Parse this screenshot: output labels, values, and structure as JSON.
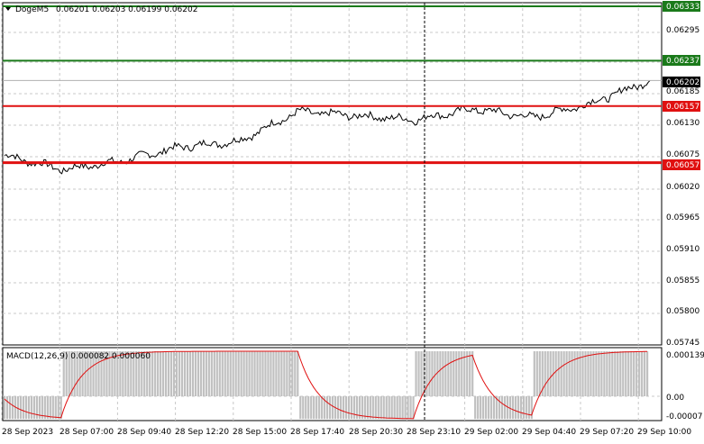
{
  "header": {
    "symbol_line": "DogeM5",
    "ohlc": "0.06201 0.06203 0.06199 0.06202"
  },
  "price_axis": {
    "ticks": [
      "0.06295",
      "0.06185",
      "0.06130",
      "0.06075",
      "0.06020",
      "0.05965",
      "0.05910",
      "0.05855",
      "0.05800",
      "0.05745"
    ]
  },
  "levels": [
    {
      "price": "0.06333",
      "color": "#1a7a1a"
    },
    {
      "price": "0.06237",
      "color": "#1a7a1a"
    },
    {
      "price": "0.06157",
      "color": "#e01010"
    },
    {
      "price": "0.06057",
      "color": "#e01010"
    }
  ],
  "current_price": "0.06202",
  "macd": {
    "label": "MACD(12,26,9) 0.000082 0.000060",
    "ticks": [
      "0.000139",
      "0.00",
      "-0.00007"
    ]
  },
  "time_axis": {
    "labels": [
      "28 Sep 2023",
      "28 Sep 07:00",
      "28 Sep 09:40",
      "28 Sep 12:20",
      "28 Sep 15:00",
      "28 Sep 17:40",
      "28 Sep 20:30",
      "28 Sep 23:10",
      "29 Sep 02:00",
      "29 Sep 04:40",
      "29 Sep 07:20",
      "29 Sep 10:00"
    ]
  },
  "chart_data": {
    "type": "line",
    "title": "DogeM5",
    "x": [
      "28 Sep 2023",
      "28 Sep 07:00",
      "28 Sep 09:40",
      "28 Sep 12:20",
      "28 Sep 15:00",
      "28 Sep 17:40",
      "28 Sep 20:30",
      "28 Sep 23:10",
      "29 Sep 02:00",
      "29 Sep 04:40",
      "29 Sep 07:20",
      "29 Sep 10:00"
    ],
    "series": [
      {
        "values": [
          0.0607,
          0.06045,
          0.0606,
          0.06085,
          0.06095,
          0.06147,
          0.0614,
          0.06133,
          0.06152,
          0.06137,
          0.06162,
          0.06202
        ]
      }
    ],
    "ylim": [
      0.05745,
      0.06333
    ],
    "grid": true,
    "colors": {
      "price_line": "#000000",
      "grid": "#c8c8c8",
      "histogram": "#c0c0c0",
      "signal": "#e01010"
    },
    "macd_ylim": [
      -7e-05,
      0.000139
    ]
  }
}
